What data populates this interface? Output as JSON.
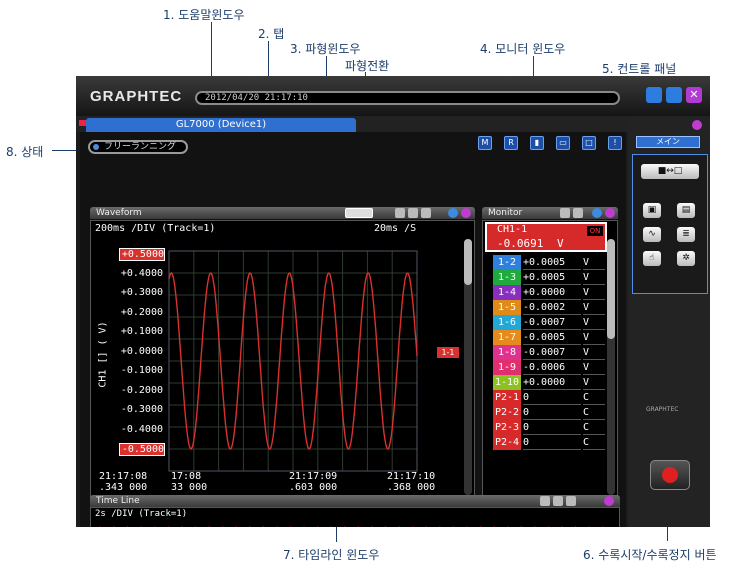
{
  "callouts": {
    "help": "1. 도움말윈도우",
    "tab": "2. 탭",
    "waveform": "3. 파형윈도우",
    "switch": "파형전환",
    "monitor": "4. 모니터 윈도우",
    "control": "5. 컨트롤 패널",
    "record": "6. 수록시작/수록정지 버튼",
    "timeline": "7. 타임라인 윈도우",
    "status": "8. 상태"
  },
  "app": {
    "brand": "GRAPHTEC",
    "datetime": "2012/04/20 21:17:10",
    "tab_label": "GL7000 (Device1)",
    "status_text": "フリーランニング"
  },
  "waveform": {
    "title": "Waveform",
    "header_left": "200ms /DIV (Track=1)",
    "header_right": "20ms /S",
    "y_axis_label": "CH1 [] ( V)",
    "y_ticks": [
      "+0.5000",
      "+0.4000",
      "+0.3000",
      "+0.2000",
      "+0.1000",
      "+0.0000",
      "-0.1000",
      "-0.2000",
      "-0.3000",
      "-0.4000",
      "-0.5000"
    ],
    "x_ticks": [
      {
        "time": "21:17:08",
        "sub": ".343 000"
      },
      {
        "time": "17:08",
        "sub": "33 000"
      },
      {
        "time": "21:17:09",
        "sub": ".603 000"
      },
      {
        "time": "21:17:10",
        "sub": ".368 000"
      }
    ],
    "marker": "1-1",
    "wave_color": "#d9312e",
    "cycles": 6.3,
    "amplitude": 0.4
  },
  "monitor": {
    "title": "Monitor",
    "main_channel": "CH1-1",
    "main_value": "-0.0691",
    "main_unit": "V",
    "main_flag": "ON",
    "rows": [
      {
        "label": "1-2",
        "value": "+0.0005",
        "unit": "V",
        "color": "#2f7fe0"
      },
      {
        "label": "1-3",
        "value": "+0.0005",
        "unit": "V",
        "color": "#1faa3c"
      },
      {
        "label": "1-4",
        "value": "+0.0000",
        "unit": "V",
        "color": "#8a2ec0"
      },
      {
        "label": "1-5",
        "value": "-0.0002",
        "unit": "V",
        "color": "#e08a1a"
      },
      {
        "label": "1-6",
        "value": "-0.0007",
        "unit": "V",
        "color": "#21a7d8"
      },
      {
        "label": "1-7",
        "value": "-0.0005",
        "unit": "V",
        "color": "#e58a1c"
      },
      {
        "label": "1-8",
        "value": "-0.0007",
        "unit": "V",
        "color": "#e0318f"
      },
      {
        "label": "1-9",
        "value": "-0.0006",
        "unit": "V",
        "color": "#e02f6e"
      },
      {
        "label": "1-10",
        "value": "+0.0000",
        "unit": "V",
        "color": "#8cc11f"
      },
      {
        "label": "P2-1",
        "value": "0",
        "unit": "C",
        "color": "#d62a2a"
      },
      {
        "label": "P2-2",
        "value": "0",
        "unit": "C",
        "color": "#d62a2a"
      },
      {
        "label": "P2-3",
        "value": "0",
        "unit": "C",
        "color": "#d62a2a"
      },
      {
        "label": "P2-4",
        "value": "0",
        "unit": "C",
        "color": "#d62a2a"
      }
    ]
  },
  "timeline": {
    "title": "Time Line",
    "header": "2s /DIV (Track=1)",
    "cycles": 38
  },
  "control": {
    "tab_label": "メイン",
    "brand_small": "GRAPHTEC",
    "buttons": [
      "switch-icon",
      "screen-icon",
      "file-icon",
      "wave-icon",
      "list-icon",
      "hand-icon",
      "gear-icon"
    ]
  }
}
